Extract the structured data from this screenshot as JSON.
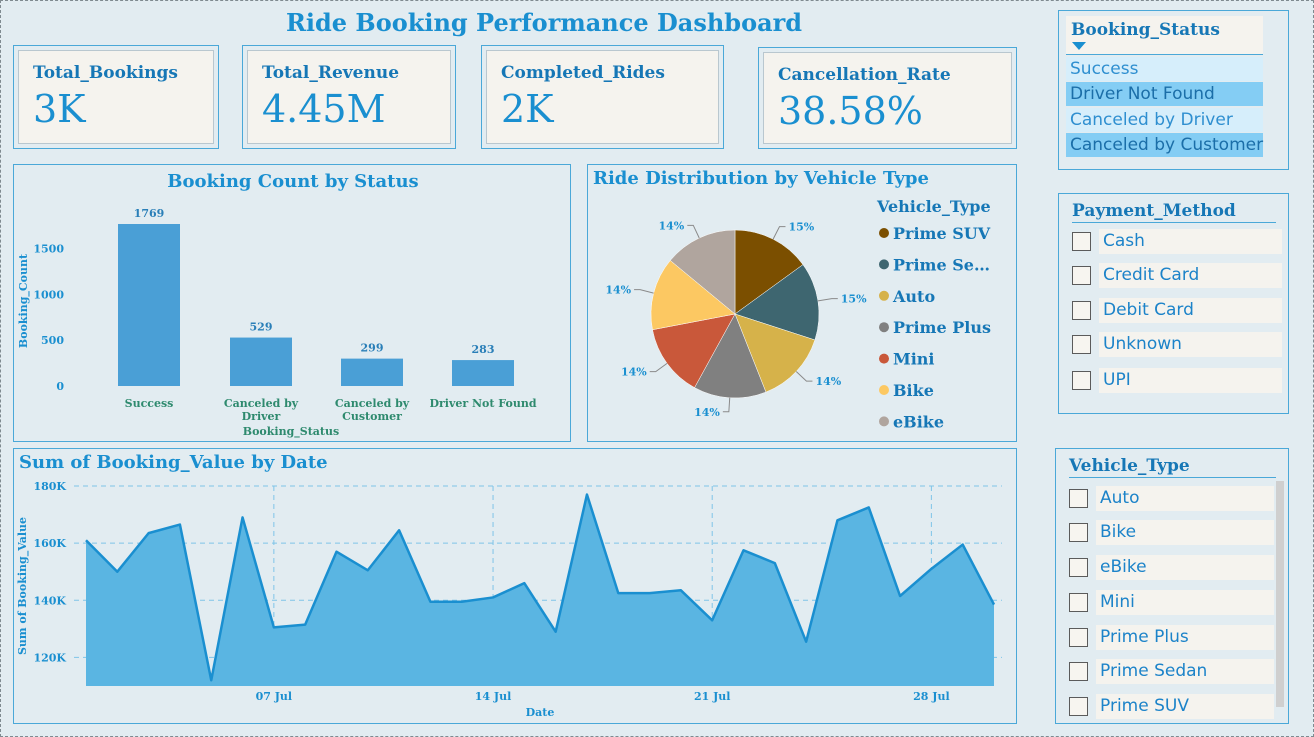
{
  "dashboard": {
    "title": "Ride Booking Performance Dashboard"
  },
  "kpis": [
    {
      "label": "Total_Bookings",
      "value": "3K"
    },
    {
      "label": "Total_Revenue",
      "value": "4.45M"
    },
    {
      "label": "Completed_Rides",
      "value": "2K"
    },
    {
      "label": "Cancellation_Rate",
      "value": "38.58%"
    }
  ],
  "status_slicer": {
    "title": "Booking_Status",
    "options": [
      "Success",
      "Driver Not Found",
      "Canceled by Driver",
      "Canceled by Customer"
    ],
    "highlighted": [
      "Driver Not Found",
      "Canceled by Customer"
    ]
  },
  "payment_slicer": {
    "title": "Payment_Method",
    "options": [
      "Cash",
      "Credit Card",
      "Debit Card",
      "Unknown",
      "UPI"
    ]
  },
  "vehicle_slicer": {
    "title": "Vehicle_Type",
    "options": [
      "Auto",
      "Bike",
      "eBike",
      "Mini",
      "Prime Plus",
      "Prime Sedan",
      "Prime SUV"
    ]
  },
  "chart_data": [
    {
      "type": "bar",
      "title": "Booking Count by Status",
      "xlabel": "Booking_Status",
      "ylabel": "Booking_Count",
      "categories": [
        "Success",
        "Canceled by Driver",
        "Canceled by Customer",
        "Driver Not Found"
      ],
      "category_lines": [
        [
          "Success"
        ],
        [
          "Canceled by",
          "Driver"
        ],
        [
          "Canceled by",
          "Customer"
        ],
        [
          "Driver Not Found"
        ]
      ],
      "values": [
        1769,
        529,
        299,
        283
      ],
      "yticks": [
        0,
        500,
        1000,
        1500
      ],
      "ylim": [
        0,
        1800
      ],
      "color": "#4a9fd6"
    },
    {
      "type": "pie",
      "title": "Ride Distribution by Vehicle Type",
      "legend_title": "Vehicle_Type",
      "legend_placement": "right",
      "slices": [
        {
          "name": "Prime SUV",
          "legend_label": "Prime SUV",
          "pct": 15,
          "label": "15%",
          "color": "#7b4f00"
        },
        {
          "name": "Prime Sedan",
          "legend_label": "Prime Se…",
          "pct": 15,
          "label": "15%",
          "color": "#3e6670"
        },
        {
          "name": "Auto",
          "legend_label": "Auto",
          "pct": 14,
          "label": "14%",
          "color": "#d6b24a"
        },
        {
          "name": "Prime Plus",
          "legend_label": "Prime Plus",
          "pct": 14,
          "label": "14%",
          "color": "#808080"
        },
        {
          "name": "Mini",
          "legend_label": "Mini",
          "pct": 14,
          "label": "14%",
          "color": "#c9583a"
        },
        {
          "name": "Bike",
          "legend_label": "Bike",
          "pct": 14,
          "label": "14%",
          "color": "#fcc862"
        },
        {
          "name": "eBike",
          "legend_label": "eBike",
          "pct": 14,
          "label": "14%",
          "color": "#b0a59e"
        }
      ]
    },
    {
      "type": "area",
      "title": "Sum of Booking_Value by Date",
      "xlabel": "Date",
      "ylabel": "Sum of Booking_Value",
      "ylim": [
        110000,
        180000
      ],
      "yticks": [
        120000,
        140000,
        160000,
        180000
      ],
      "ytick_labels": [
        "120K",
        "140K",
        "160K",
        "180K"
      ],
      "x": [
        "2024-07-01",
        "2024-07-02",
        "2024-07-03",
        "2024-07-04",
        "2024-07-05",
        "2024-07-06",
        "2024-07-07",
        "2024-07-08",
        "2024-07-09",
        "2024-07-10",
        "2024-07-11",
        "2024-07-12",
        "2024-07-13",
        "2024-07-14",
        "2024-07-15",
        "2024-07-16",
        "2024-07-17",
        "2024-07-18",
        "2024-07-19",
        "2024-07-20",
        "2024-07-21",
        "2024-07-22",
        "2024-07-23",
        "2024-07-24",
        "2024-07-25",
        "2024-07-26",
        "2024-07-27",
        "2024-07-28",
        "2024-07-29",
        "2024-07-30"
      ],
      "values": [
        161000,
        150000,
        163500,
        166500,
        112000,
        169000,
        130500,
        131500,
        157000,
        150500,
        164500,
        139500,
        139500,
        141000,
        146000,
        129000,
        177000,
        142500,
        142500,
        143500,
        133000,
        157500,
        153000,
        125500,
        168000,
        172500,
        141500,
        151000,
        159500,
        138500
      ],
      "xtick_dates": [
        "2024-07-07",
        "2024-07-14",
        "2024-07-21",
        "2024-07-28"
      ],
      "xtick_labels": [
        "07 Jul",
        "14 Jul",
        "21 Jul",
        "28 Jul"
      ],
      "grid": true,
      "color": "#5ab5e2"
    }
  ]
}
